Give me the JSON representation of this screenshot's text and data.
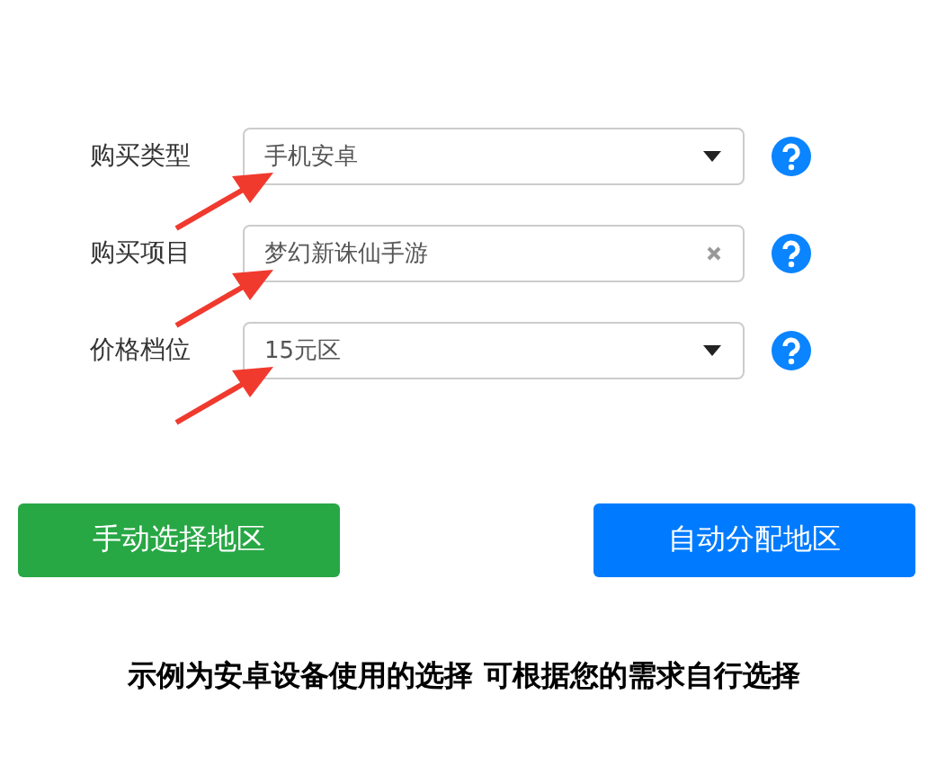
{
  "fields": [
    {
      "label": "购买类型",
      "kind": "select",
      "value": "手机安卓",
      "annotated": true
    },
    {
      "label": "购买项目",
      "kind": "clearable",
      "value": "梦幻新诛仙手游",
      "annotated": true
    },
    {
      "label": "价格档位",
      "kind": "select",
      "value": "15元区",
      "annotated": true
    }
  ],
  "buttons": [
    {
      "label": "手动选择地区",
      "kind": "success"
    },
    {
      "label": "自动分配地区",
      "kind": "primary"
    }
  ],
  "note": "示例为安卓设备使用的选择 可根据您的需求自行选择"
}
